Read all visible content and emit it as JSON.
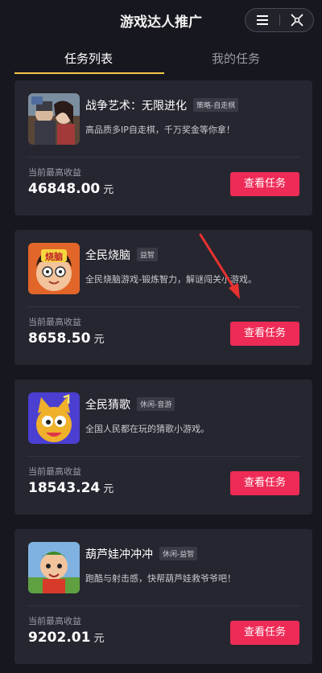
{
  "header": {
    "title": "游戏达人推广"
  },
  "tabs": [
    {
      "label": "任务列表",
      "active": true
    },
    {
      "label": "我的任务",
      "active": false
    }
  ],
  "accent": "#ee2b56",
  "tab_underline_color": "#f7c948",
  "games": [
    {
      "name": "战争艺术：无限进化",
      "tag": "策略-自走棋",
      "desc": "高品质多IP自走棋，千万奖金等你拿！",
      "earn_label": "当前最高收益",
      "earn_value": "46848.00",
      "earn_unit": "元",
      "button": "查看任务"
    },
    {
      "name": "全民烧脑",
      "tag": "益智",
      "desc": "全民烧脑游戏-锻炼智力，解谜闯关小游戏。",
      "earn_label": "当前最高收益",
      "earn_value": "8658.50",
      "earn_unit": "元",
      "button": "查看任务",
      "thumb_text": "烧脑"
    },
    {
      "name": "全民猜歌",
      "tag": "休闲-音游",
      "desc": "全国人民都在玩的猜歌小游戏。",
      "earn_label": "当前最高收益",
      "earn_value": "18543.24",
      "earn_unit": "元",
      "button": "查看任务"
    },
    {
      "name": "葫芦娃冲冲冲",
      "tag": "休闲-益智",
      "desc": "跑酷与射击感，快帮葫芦娃救爷爷吧！",
      "earn_label": "当前最高收益",
      "earn_value": "9202.01",
      "earn_unit": "元",
      "button": "查看任务"
    }
  ]
}
